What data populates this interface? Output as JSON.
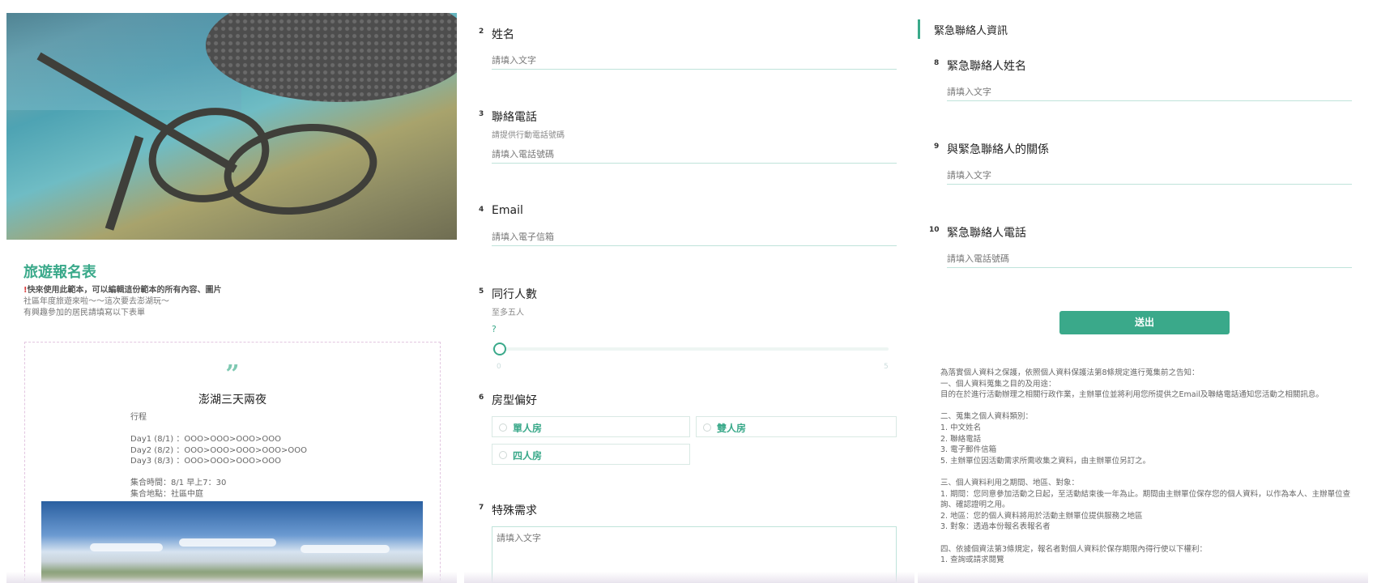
{
  "left": {
    "title": "旅遊報名表",
    "intro_warning": "快來使用此範本，可以編輯這份範本的所有內容、圖片",
    "intro_line2": "社區年度旅遊來啦～～這次要去澎湖玩～",
    "intro_line3": "有興趣參加的居民請填寫以下表單",
    "card_title": "澎湖三天兩夜",
    "card_body": "行程\n\nDay1 (8/1) ：OOO>OOO>OOO>OOO\nDay2 (8/2) ：OOO>OOO>OOO>OOO>OOO\nDay3 (8/3) ：OOO>OOO>OOO>OOO\n\n集合時間：8/1 早上7：30\n集合地點：社區中庭"
  },
  "middle": {
    "q2": {
      "num": "2",
      "label": "姓名",
      "placeholder": "請填入文字"
    },
    "q3": {
      "num": "3",
      "label": "聯絡電話",
      "hint": "請提供行動電話號碼",
      "placeholder": "請填入電話號碼"
    },
    "q4": {
      "num": "4",
      "label": "Email",
      "placeholder": "請填入電子信箱"
    },
    "q5": {
      "num": "5",
      "label": "同行人數",
      "hint": "至多五人",
      "value": "?",
      "min": "0",
      "max": "5"
    },
    "q6": {
      "num": "6",
      "label": "房型偏好",
      "options": [
        "單人房",
        "雙人房",
        "四人房"
      ]
    },
    "q7": {
      "num": "7",
      "label": "特殊需求",
      "placeholder": "請填入文字"
    }
  },
  "right": {
    "section_title": "緊急聯絡人資訊",
    "q8": {
      "num": "8",
      "label": "緊急聯絡人姓名",
      "placeholder": "請填入文字"
    },
    "q9": {
      "num": "9",
      "label": "與緊急聯絡人的關係",
      "placeholder": "請填入文字"
    },
    "q10": {
      "num": "10",
      "label": "緊急聯絡人電話",
      "placeholder": "請填入電話號碼"
    },
    "submit_label": "送出",
    "privacy_text": "為落實個人資料之保護，依照個人資料保護法第8條規定進行蒐集前之告知：\n一、個人資料蒐集之目的及用途：\n目的在於進行活動辦理之相關行政作業，主辦單位並將利用您所提供之Email及聯絡電話通知您活動之相關訊息。\n\n二、蒐集之個人資料類別：\n1. 中文姓名\n2. 聯絡電話\n3. 電子郵件信箱\n5. 主辦單位因活動需求所需收集之資料，由主辦單位另訂之。\n\n三、個人資料利用之期間、地區、對象：\n1. 期間：您同意參加活動之日起，至活動結束後一年為止。期間由主辦單位保存您的個人資料，以作為本人、主辦單位查詢、確認證明之用。\n2. 地區：您的個人資料將用於活動主辦單位提供服務之地區\n3. 對象：透過本份報名表報名者\n\n四、依據個資法第3條規定，報名者對個人資料於保存期限內得行使以下權利：\n1. 查詢或請求閱覽"
  },
  "colors": {
    "accent": "#3aa98a",
    "underline": "#bfe3da"
  }
}
